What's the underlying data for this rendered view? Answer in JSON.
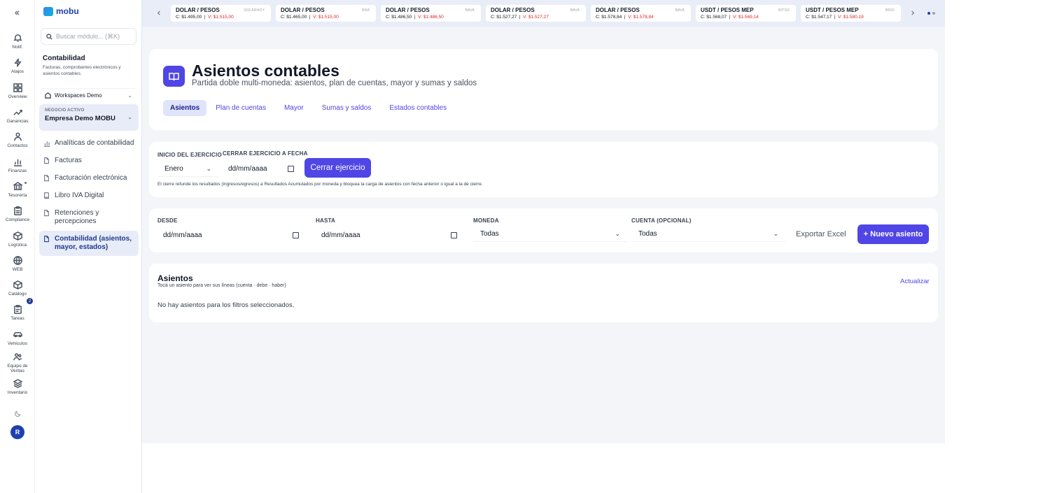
{
  "rail": {
    "collapse_icon": "double-chevron-left",
    "items": [
      {
        "label": "Notif.",
        "icon": "bell"
      },
      {
        "label": "Atajos",
        "icon": "bolt"
      },
      {
        "label": "Overview",
        "icon": "grid"
      },
      {
        "label": "Ganancias",
        "icon": "trend"
      },
      {
        "label": "Contactos",
        "icon": "users"
      },
      {
        "label": "Finanzas",
        "icon": "bar-chart"
      },
      {
        "label": "Tesorería",
        "icon": "bank"
      },
      {
        "label": "Compliance",
        "icon": "clipboard"
      },
      {
        "label": "Logística",
        "icon": "box"
      },
      {
        "label": "WEB",
        "icon": "globe"
      },
      {
        "label": "Catálogo",
        "icon": "cube"
      },
      {
        "label": "Tareas",
        "icon": "clipboard-list",
        "badge": "2"
      },
      {
        "label": "Vehículos",
        "icon": "car"
      },
      {
        "label": "Equipo de Ventas",
        "icon": "team"
      },
      {
        "label": "Inventario",
        "icon": "stack"
      }
    ],
    "avatar": "R"
  },
  "sidebar": {
    "logo": "mobu",
    "search_placeholder": "Buscar módulo... (⌘K)",
    "section_title": "Contabilidad",
    "section_desc": "Facturas, comprobantes electrónicos y asientos contables.",
    "workspace": "Workspaces Demo",
    "business_label": "NEGOCIO ACTIVO",
    "business_name": "Empresa Demo MOBU",
    "nav": [
      {
        "label": "Analíticas de contabilidad",
        "icon": "bar-chart"
      },
      {
        "label": "Facturas",
        "icon": "doc"
      },
      {
        "label": "Facturación electrónica",
        "icon": "doc"
      },
      {
        "label": "Libro IVA Digital",
        "icon": "book"
      },
      {
        "label": "Retenciones y percepciones",
        "icon": "doc"
      },
      {
        "label": "Contabilidad (asientos, mayor, estados)",
        "icon": "doc",
        "active": true
      }
    ]
  },
  "ticker": [
    {
      "name": "DOLAR / PESOS",
      "source": "DOLARHOY",
      "c": "C: $1.495,00",
      "v": "V: $1.515,00"
    },
    {
      "name": "DOLAR / PESOS",
      "source": "BNA",
      "c": "C: $1.465,00",
      "v": "V: $1.515,00"
    },
    {
      "name": "DOLAR / PESOS",
      "source": "BAVA",
      "c": "C: $1.486,50",
      "v": "V: $1.486,50"
    },
    {
      "name": "DOLAR / PESOS",
      "source": "BAVA",
      "c": "C: $1.527,27",
      "v": "V: $1.527,27"
    },
    {
      "name": "DOLAR / PESOS",
      "source": "BAVA",
      "c": "C: $1.578,84",
      "v": "V: $1.578,84"
    },
    {
      "name": "USDT / PESOS MEP",
      "source": "BITSO",
      "c": "C: $1.568,07",
      "v": "V: $1.569,14"
    },
    {
      "name": "USDT / PESOS MEP",
      "source": "BRIO",
      "c": "C: $1.547,17",
      "v": "V: $1.580,19"
    }
  ],
  "header": {
    "title": "Asientos contables",
    "subtitle": "Partida doble multi-moneda: asientos, plan de cuentas, mayor y sumas y saldos",
    "tabs": [
      "Asientos",
      "Plan de cuentas",
      "Mayor",
      "Sumas y saldos",
      "Estados contables"
    ]
  },
  "close": {
    "start_label": "INICIO DEL EJERCICIO",
    "start_value": "Enero",
    "close_label": "CERRAR EJERCICIO A FECHA",
    "close_date": "dd/mm/aaaa",
    "button": "Cerrar ejercicio",
    "note": "El cierre refunde los resultados (ingresos/egresos) a Resultados Acumulados por moneda y bloquea la carga de asientos con fecha anterior o igual a la de cierre."
  },
  "filters": {
    "desde_label": "DESDE",
    "desde_value": "dd/mm/aaaa",
    "hasta_label": "HASTA",
    "hasta_value": "dd/mm/aaaa",
    "moneda_label": "MONEDA",
    "moneda_value": "Todas",
    "cuenta_label": "CUENTA (OPCIONAL)",
    "cuenta_value": "Todas",
    "export": "Exportar Excel",
    "new": "+ Nuevo asiento"
  },
  "list": {
    "title": "Asientos",
    "hint": "Tocá un asiento para ver sus líneas (cuenta · debe · haber)",
    "refresh": "Actualizar",
    "empty": "No hay asientos para los filtros seleccionados."
  }
}
